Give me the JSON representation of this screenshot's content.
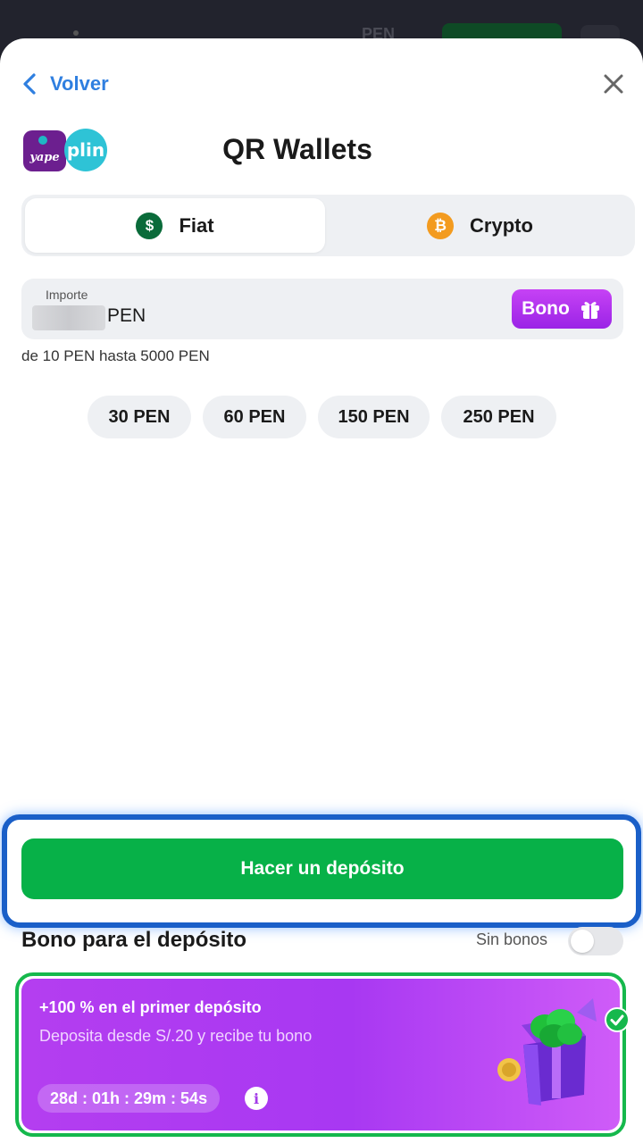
{
  "background": {
    "currency": "PEN"
  },
  "header": {
    "back_label": "Volver"
  },
  "title": "QR Wallets",
  "logo": {
    "yape": "yape",
    "plin": "plin"
  },
  "tabs": [
    {
      "label": "Fiat",
      "icon": "$",
      "active": true
    },
    {
      "label": "Crypto",
      "icon": "₿",
      "active": false
    }
  ],
  "amount": {
    "label": "Importe",
    "currency": "PEN",
    "bono_label": "Bono",
    "range": "de 10 PEN hasta 5000 PEN"
  },
  "presets": [
    "30 PEN",
    "60 PEN",
    "150 PEN",
    "250 PEN"
  ],
  "deposit_button": "Hacer un depósito",
  "bonus": {
    "title": "Bono para el depósito",
    "toggle_label": "Sin bonos",
    "card": {
      "headline": "+100 % en el primer depósito",
      "subtitle": "Deposita desde S/.20 y recibe tu bono",
      "timer": "28d : 01h : 29m : 54s",
      "info_icon": "i"
    }
  },
  "colors": {
    "accent_blue": "#2f7fe0",
    "primary_green": "#07b148",
    "promo_purple": "#b43ef0",
    "bono_purple": "#c642f5"
  }
}
